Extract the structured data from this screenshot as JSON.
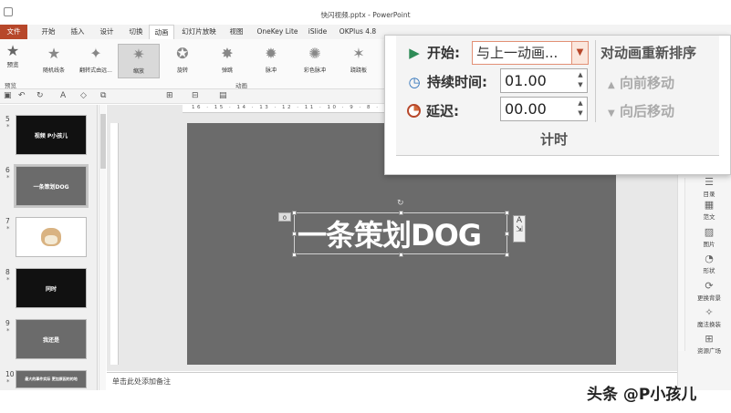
{
  "window": {
    "title": "快闪视频.pptx - PowerPoint"
  },
  "tabs": [
    {
      "label": "文件",
      "left": 0
    },
    {
      "label": "开始"
    },
    {
      "label": "插入"
    },
    {
      "label": "设计"
    },
    {
      "label": "切换"
    },
    {
      "label": "动画"
    },
    {
      "label": "幻灯片放映"
    },
    {
      "label": "视图"
    },
    {
      "label": "OneKey Lite"
    },
    {
      "label": "iSlide"
    },
    {
      "label": "OKPlus 4.8"
    }
  ],
  "ribbon": {
    "preview_label": "预览",
    "preview_group": "预览",
    "animations": [
      "随机线条",
      "翻转式由远...",
      "缩放",
      "旋转",
      "弹跳",
      "脉冲",
      "彩色脉冲",
      "跷跷板"
    ],
    "group_label": "动画"
  },
  "thumbnails": [
    {
      "num": "5",
      "text": "视频  P小孩儿",
      "style": "black"
    },
    {
      "num": "6",
      "text": "一条策划DOG",
      "style": "gray"
    },
    {
      "num": "7",
      "text": "",
      "style": "white"
    },
    {
      "num": "8",
      "text": "同时",
      "style": "black"
    },
    {
      "num": "9",
      "text": "我还是",
      "style": "gray"
    },
    {
      "num": "10",
      "text": "最大的事件实际    更加原因的的地",
      "style": "gray"
    }
  ],
  "slide": {
    "main_text": "一条策划DOG",
    "anim_order": "0"
  },
  "ruler_text": "16 · 15 · 14 · 13 · 12 · 11 · 10 · 9 · 8 · 7 · 6 · 5 · 4 · 3 · 2 · 1 · 0 · 1 · 2 · 3 · 4 · 5 · 6 · 7 · 8 · 9 · 10 · 11 · 12 · 13 · 14 · 15 · 16",
  "notes_placeholder": "单击此处添加备注",
  "side_panel": [
    "目录",
    "范文",
    "图片",
    "形状",
    "更换背景",
    "魔法换装",
    "资源广场"
  ],
  "timing": {
    "start_label": "开始:",
    "start_value": "与上一动画...",
    "duration_label": "持续时间:",
    "duration_value": "01.00",
    "delay_label": "延迟:",
    "delay_value": "00.00",
    "group_title": "计时",
    "reorder_title": "对动画重新排序",
    "move_earlier": "向前移动",
    "move_later": "向后移动"
  },
  "watermark": "头条 @P小孩儿"
}
